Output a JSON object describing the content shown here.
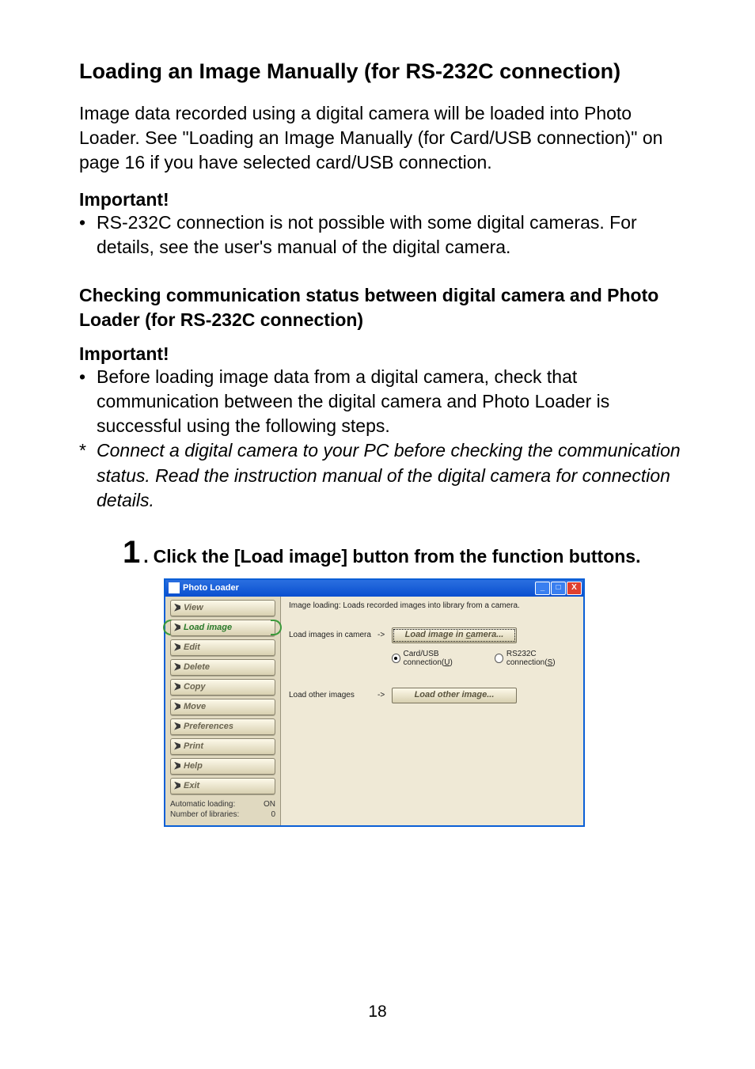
{
  "heading": "Loading an Image Manually (for RS-232C connection)",
  "intro": "Image data recorded using a digital camera will be loaded into Photo Loader. See \"Loading an Image Manually (for Card/USB connection)\" on page 16 if you have selected card/USB connection.",
  "important_label_1": "Important!",
  "bullet_1": "RS-232C connection is not possible with some digital cameras. For details, see the user's manual of the digital camera.",
  "subheading": "Checking communication status between digital camera and Photo Loader (for RS-232C connection)",
  "important_label_2": "Important!",
  "bullet_2": "Before loading image data from a digital camera, check that communication between the digital camera and Photo Loader is successful using the following steps.",
  "star_note": "Connect a digital camera to your PC before checking the communication status. Read the instruction manual of the digital camera for connection details.",
  "step": {
    "num": "1",
    "dot": ".",
    "text": "Click the [Load image] button from the function buttons."
  },
  "app": {
    "title": "Photo Loader",
    "sidebar": {
      "items": [
        {
          "label": "View"
        },
        {
          "label": "Load image"
        },
        {
          "label": "Edit"
        },
        {
          "label": "Delete"
        },
        {
          "label": "Copy"
        },
        {
          "label": "Move"
        },
        {
          "label": "Preferences"
        },
        {
          "label": "Print"
        },
        {
          "label": "Help"
        },
        {
          "label": "Exit"
        }
      ],
      "status": {
        "auto_label": "Automatic loading:",
        "auto_value": "ON",
        "lib_label": "Number of libraries:",
        "lib_value": "0"
      }
    },
    "pane": {
      "desc": "Image loading: Loads recorded images into library from a camera.",
      "row1_label": "Load images in camera",
      "arrow": "->",
      "btn1_prefix": "Load image in ",
      "btn1_hotkey": "c",
      "btn1_suffix": "amera...",
      "radio1_prefix": "Card/USB connection(",
      "radio1_hotkey": "U",
      "radio1_suffix": ")",
      "radio2_prefix": "RS232C connection(",
      "radio2_hotkey": "S",
      "radio2_suffix": ")",
      "row2_label": "Load other images",
      "btn2": "Load other image..."
    }
  },
  "page_number": "18"
}
